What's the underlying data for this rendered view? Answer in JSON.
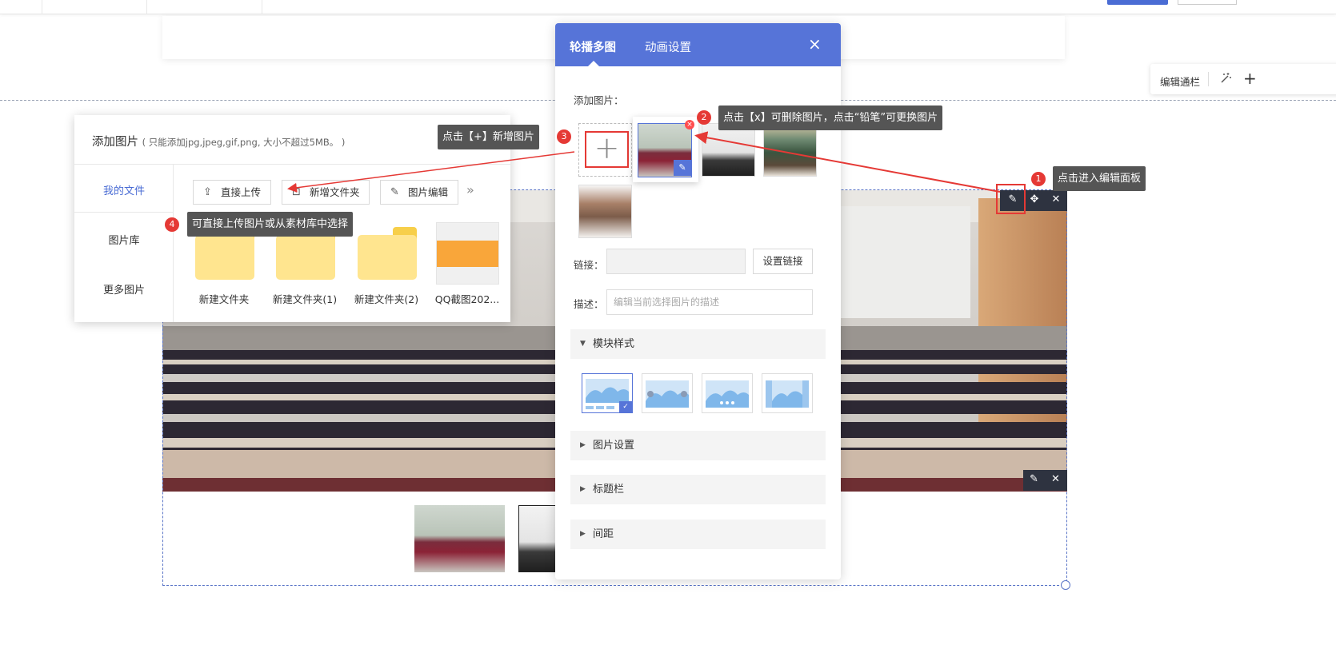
{
  "colors": {
    "accent": "#5674d8",
    "annotation_red": "#e53935",
    "tooltip_bg": "#555555",
    "folder_yellow": "#ffe58f"
  },
  "edit_bar": {
    "label": "编辑通栏",
    "icons": [
      "magic-wand-icon",
      "plus-icon"
    ]
  },
  "module_tools": {
    "icons": [
      "pencil-icon",
      "move-icon",
      "close-icon"
    ]
  },
  "slide_tools": {
    "icons": [
      "pencil-icon",
      "close-icon"
    ]
  },
  "add_panel": {
    "title": "添加图片",
    "subtitle": "( 只能添加jpg,jpeg,gif,png, 大小不超过5MB。 )",
    "sidebar": [
      {
        "label": "我的文件",
        "active": true
      },
      {
        "label": "图片库",
        "active": false
      },
      {
        "label": "更多图片",
        "active": false
      }
    ],
    "buttons": [
      {
        "label": "直接上传",
        "icon": "upload-icon"
      },
      {
        "label": "新增文件夹",
        "icon": "new-folder-icon"
      },
      {
        "label": "图片编辑",
        "icon": "edit-icon"
      }
    ],
    "more_icon": "double-chevron-right-icon",
    "files": [
      {
        "name": "新建文件夹",
        "type": "folder"
      },
      {
        "name": "新建文件夹(1)",
        "type": "folder"
      },
      {
        "name": "新建文件夹(2)",
        "type": "folder"
      },
      {
        "name": "QQ截图202...",
        "type": "image"
      }
    ]
  },
  "carousel_panel": {
    "tabs": [
      {
        "label": "轮播多图",
        "active": true
      },
      {
        "label": "动画设置",
        "active": false
      }
    ],
    "add_images_label": "添加图片：",
    "link_label": "链接：",
    "link_value": "",
    "set_link_button": "设置链接",
    "desc_label": "描述：",
    "desc_placeholder": "编辑当前选择图片的描述",
    "sections": [
      {
        "label": "模块样式",
        "expanded": true
      },
      {
        "label": "图片设置",
        "expanded": false
      },
      {
        "label": "标题栏",
        "expanded": false
      },
      {
        "label": "间距",
        "expanded": false
      }
    ],
    "style_options": 4,
    "selected_style": 0
  },
  "annotations": [
    {
      "number": "1",
      "text": "点击进入编辑面板"
    },
    {
      "number": "2",
      "text": "点击【x】可删除图片，点击“铅笔”可更换图片"
    },
    {
      "number": "3",
      "text": "点击【+】新增图片"
    },
    {
      "number": "4",
      "text": "可直接上传图片或从素材库中选择"
    }
  ]
}
